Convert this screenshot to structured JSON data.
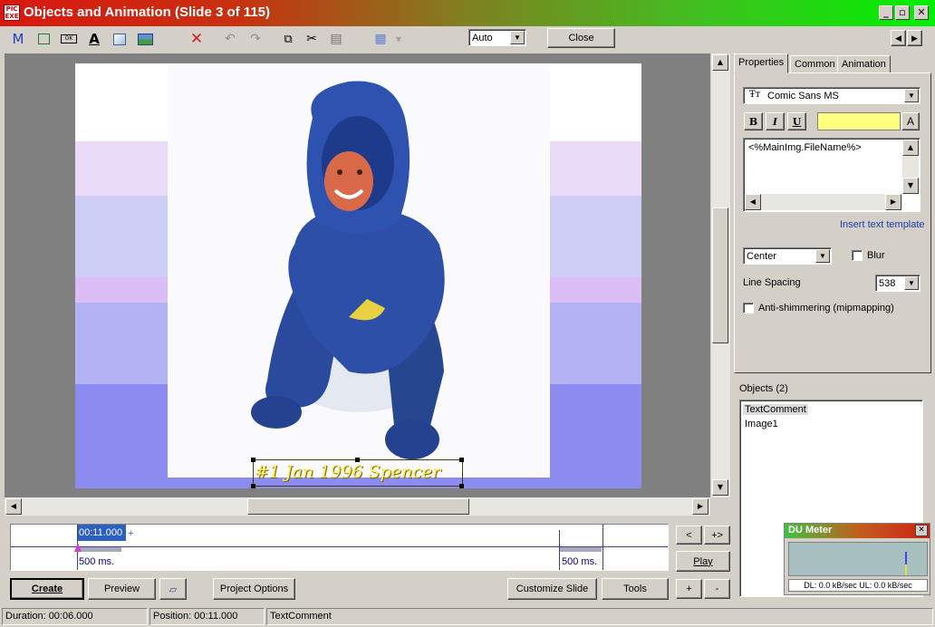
{
  "window": {
    "title": "Objects and Animation  (Slide 3 of 115)",
    "app_icon_text": "PIC\nEXE",
    "minimize": "_",
    "maximize": "▫",
    "close": "✕"
  },
  "toolbar": {
    "zoom_value": "Auto",
    "close_label": "Close",
    "icons": [
      "text-m-icon",
      "rectangle-icon",
      "ok-button-icon",
      "text-a-icon",
      "frame-icon",
      "image-icon",
      "delete-icon",
      "undo-icon",
      "redo-icon",
      "copy-icon",
      "cut-icon",
      "paste-icon",
      "grid-icon"
    ]
  },
  "slide": {
    "caption": "#1 Jan 1996 Spencer",
    "caption_color": "#f8f060"
  },
  "tabs": {
    "properties": "Properties",
    "common": "Common",
    "animation": "Animation"
  },
  "properties": {
    "font_name": "Comic Sans MS",
    "bold": "B",
    "italic": "I",
    "underline": "U",
    "color_button": "A",
    "text_color": "#ffff80",
    "text_value": "<%MainImg.FileName%>",
    "insert_template_link": "Insert text template",
    "align_value": "Center",
    "blur_label": "Blur",
    "line_spacing_label": "Line Spacing",
    "line_spacing_value": "538",
    "anti_shimmer_label": "Anti-shimmering (mipmapping)"
  },
  "objects": {
    "header": "Objects (2)",
    "items": [
      "TextComment",
      "Image1"
    ]
  },
  "timeline": {
    "position_label": "00:11.000",
    "plus": "+",
    "left_duration": "500 ms.",
    "right_duration": "500 ms.",
    "nav_prev": "<",
    "nav_next": "+>",
    "play": "Play",
    "add": "+",
    "remove": "-"
  },
  "bottom_buttons": {
    "create": "Create",
    "preview": "Preview",
    "project_options": "Project Options",
    "customize_slide": "Customize Slide",
    "tools": "Tools"
  },
  "du_meter": {
    "title": "DU Meter",
    "close": "✕",
    "stats": "DL: 0.0 kB/sec  UL: 0.0 kB/sec"
  },
  "status": {
    "duration": "Duration:  00:06.000",
    "position": "Position:  00:11.000",
    "object": "TextComment"
  }
}
